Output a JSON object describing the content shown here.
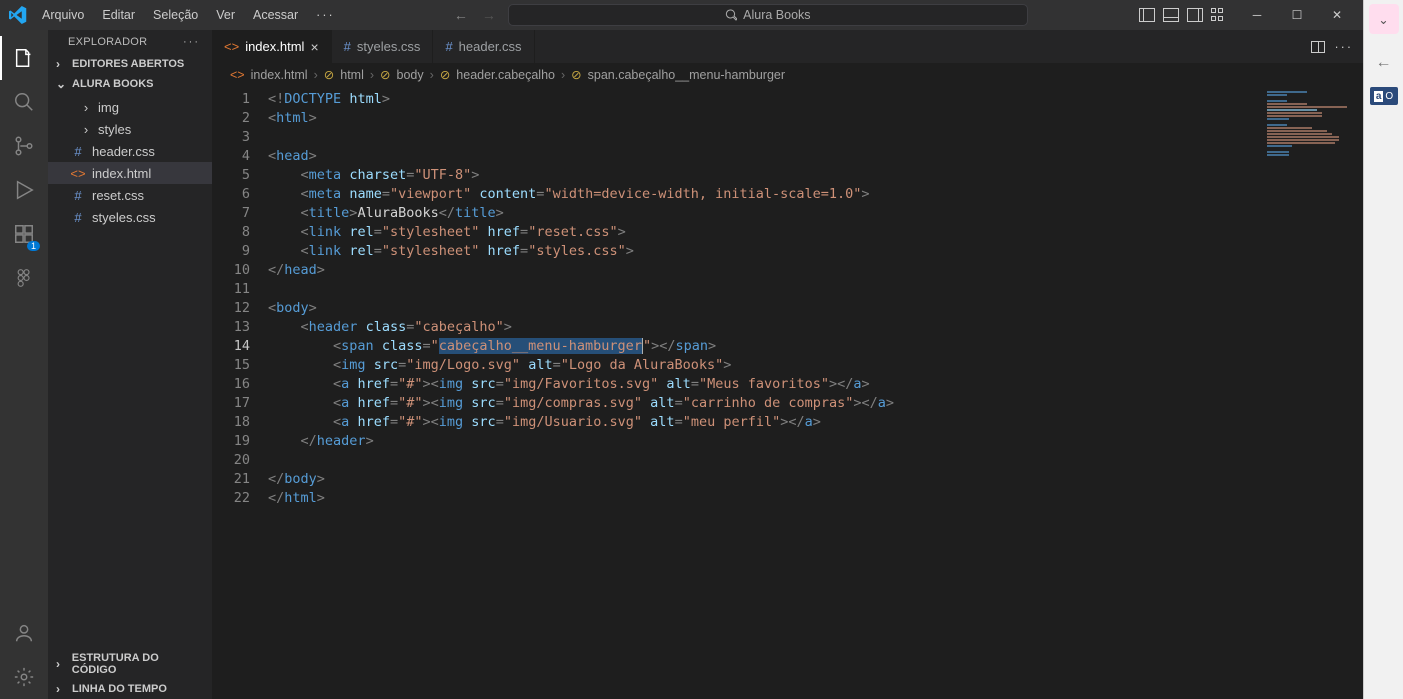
{
  "menu": [
    "Arquivo",
    "Editar",
    "Seleção",
    "Ver",
    "Acessar"
  ],
  "commandCenter": "Alura Books",
  "sidebar": {
    "title": "EXPLORADOR",
    "sections": {
      "openEditors": "EDITORES ABERTOS",
      "folder": "ALURA BOOKS",
      "outline": "ESTRUTURA DO CÓDIGO",
      "timeline": "LINHA DO TEMPO"
    },
    "tree": [
      {
        "label": "img",
        "type": "folder"
      },
      {
        "label": "styles",
        "type": "folder"
      },
      {
        "label": "header.css",
        "type": "css"
      },
      {
        "label": "index.html",
        "type": "html",
        "selected": true
      },
      {
        "label": "reset.css",
        "type": "css"
      },
      {
        "label": "styeles.css",
        "type": "css"
      }
    ]
  },
  "tabs": [
    {
      "label": "index.html",
      "type": "html",
      "active": true
    },
    {
      "label": "styeles.css",
      "type": "css"
    },
    {
      "label": "header.css",
      "type": "css"
    }
  ],
  "breadcrumbs": [
    "index.html",
    "html",
    "body",
    "header.cabeçalho",
    "span.cabeçalho__menu-hamburger"
  ],
  "extensionsBadge": "1",
  "rightPane": {
    "item": "O"
  }
}
